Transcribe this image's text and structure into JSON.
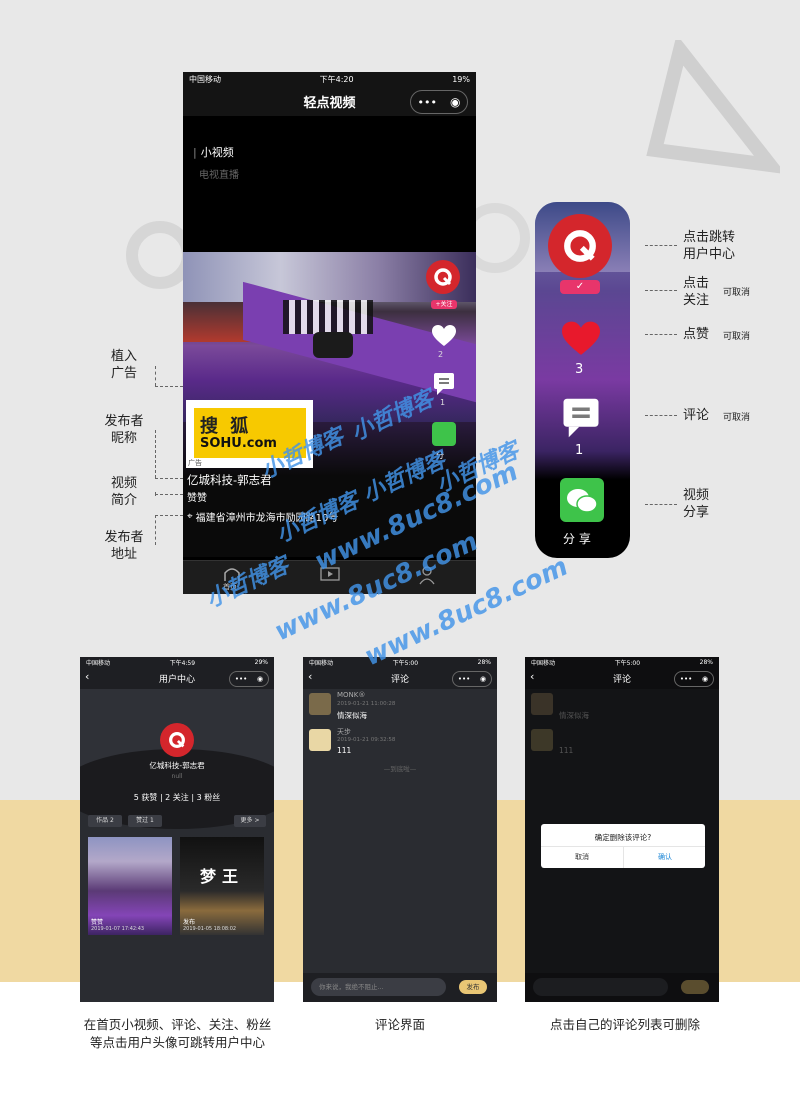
{
  "main_phone": {
    "status": {
      "carrier": "中国移动",
      "time": "下午4:20",
      "battery": "19%"
    },
    "title": "轻点视频",
    "tabs": [
      "小视频",
      "电视直播"
    ],
    "ad_tag": "广告",
    "ad_brand_cn": "搜 狐",
    "ad_brand_en": "SOHU.com",
    "follow_label": "+关注",
    "like_count": "2",
    "comment_count": "1",
    "share_label": "分",
    "publisher_nickname": "亿城科技-郭志君",
    "video_intro": "赞赞",
    "publisher_address": "福建省漳州市龙海市励园路10号",
    "bottom_tab_home": "首页"
  },
  "zoom_panel": {
    "like_count": "3",
    "comment_count": "1",
    "share_label": "分 享"
  },
  "labels_left": [
    {
      "text": "植入\n广告"
    },
    {
      "text": "发布者\n昵称"
    },
    {
      "text": "视频\n简介"
    },
    {
      "text": "发布者\n地址"
    }
  ],
  "labels_right": [
    {
      "text": "点击跳转\n用户中心",
      "note": ""
    },
    {
      "text": "点击\n关注",
      "note": "可取消"
    },
    {
      "text": "点赞",
      "note": "可取消"
    },
    {
      "text": "评论",
      "note": "可取消"
    },
    {
      "text": "视频\n分享",
      "note": ""
    }
  ],
  "watermarks": [
    "小哲博客",
    "小哲博客",
    "小哲博客 小哲博客",
    "小哲博客 小哲博客",
    "小哲博客 小哲博客",
    "www.8uc8.com",
    "www.8uc8.com",
    "www.8uc8.com",
    "www.8uc8.com",
    "小哲博客",
    "小哲博客"
  ],
  "user_center": {
    "status": {
      "carrier": "中国移动",
      "time": "下午4:59",
      "battery": "29%"
    },
    "title": "用户中心",
    "name": "亿城科技-郭志君",
    "sub": "null",
    "stats": "5 获赞 | 2 关注 | 3 粉丝",
    "tab_works": "作品 2",
    "tab_liked": "赞过 1",
    "more": "更多 >",
    "card1_text": "赞赞",
    "card1_date": "2019-01-07 17:42:43",
    "card2_title": "梦王",
    "card2_text": "发布",
    "card2_date": "2019-01-05 18:08:02"
  },
  "comments": {
    "status": {
      "carrier": "中国移动",
      "time": "下午5:00",
      "battery": "28%"
    },
    "title": "评论",
    "items": [
      {
        "name": "MONK®",
        "date": "2019-01-21 11:00:28",
        "text": "情深似海"
      },
      {
        "name": "天步",
        "date": "2019-01-21 09:32:58",
        "text": "111"
      }
    ],
    "end_text": "—到底啦—",
    "input_placeholder": "你来说，我绝不阻止...",
    "send_label": "发布"
  },
  "delete_dialog": {
    "status": {
      "carrier": "中国移动",
      "time": "下午5:00",
      "battery": "28%"
    },
    "title": "评论",
    "question": "确定删除该评论?",
    "cancel": "取消",
    "confirm": "确认"
  },
  "captions": [
    "在首页小视频、评论、关注、粉丝\n等点击用户头像可跳转用户中心",
    "评论界面",
    "点击自己的评论列表可删除"
  ],
  "colors": {
    "accent_red": "#d4262c",
    "send_yellow": "#e9c675",
    "confirm_blue": "#1c86d6",
    "watermark_blue": "#4294e8"
  }
}
